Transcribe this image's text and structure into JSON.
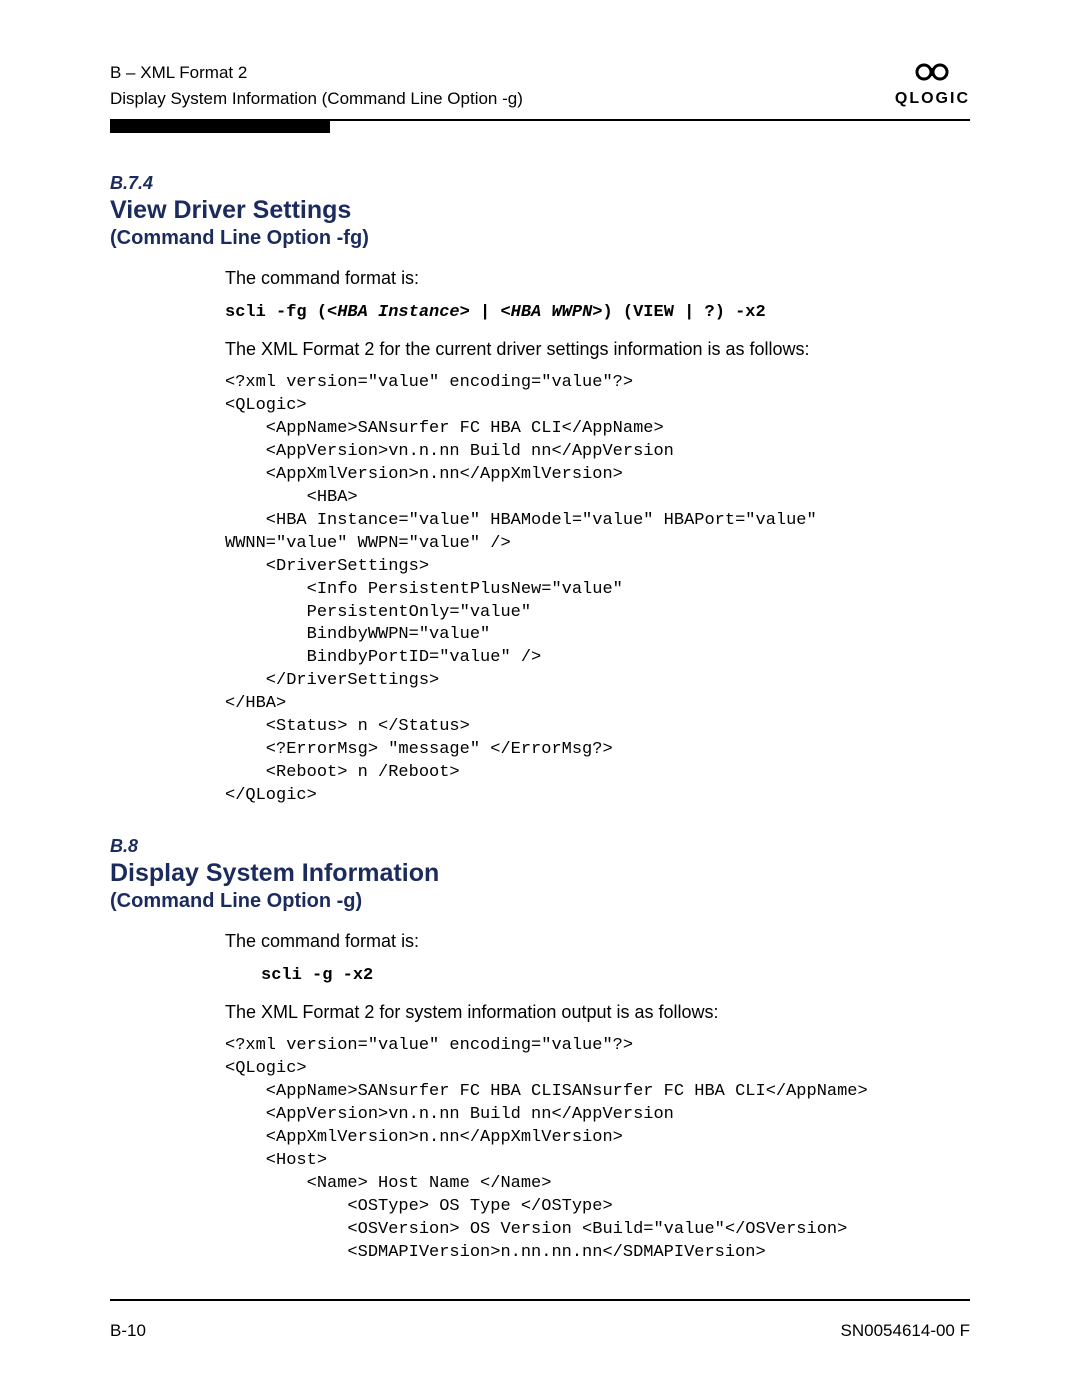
{
  "header": {
    "appendix": "B – XML Format 2",
    "topic": "Display System Information (Command Line Option -g)",
    "brand_glyph": "⚙︎",
    "brand_text": "QLOGIC"
  },
  "section1": {
    "number": "B.7.4",
    "title": "View Driver Settings",
    "subtitle": "(Command Line Option -fg)",
    "intro": "The command format is:",
    "cmd_prefix": "scli -fg (<",
    "cmd_it1": "HBA Instance",
    "cmd_mid": "> | <",
    "cmd_it2": "HBA WWPN",
    "cmd_suffix": ">) (VIEW | ?) -x2",
    "desc": "The XML Format 2 for the current driver settings information is as follows:",
    "code": "<?xml version=\"value\" encoding=\"value\"?>\n<QLogic>\n    <AppName>SANsurfer FC HBA CLI</AppName>\n    <AppVersion>vn.n.nn Build nn</AppVersion\n    <AppXmlVersion>n.nn</AppXmlVersion>\n        <HBA>\n    <HBA Instance=\"value\" HBAModel=\"value\" HBAPort=\"value\"\nWWNN=\"value\" WWPN=\"value\" />\n    <DriverSettings>\n        <Info PersistentPlusNew=\"value\"\n        PersistentOnly=\"value\"\n        BindbyWWPN=\"value\"\n        BindbyPortID=\"value\" />\n    </DriverSettings>\n</HBA>\n    <Status> n </Status>\n    <?ErrorMsg> \"message\" </ErrorMsg?>\n    <Reboot> n /Reboot>\n</QLogic>"
  },
  "section2": {
    "number": "B.8",
    "title": "Display System Information",
    "subtitle": "(Command Line Option -g)",
    "intro": "The command format is:",
    "cmd": "scli -g -x2",
    "desc": "The XML Format 2 for system information output is as follows:",
    "code": "<?xml version=\"value\" encoding=\"value\"?>\n<QLogic>\n    <AppName>SANsurfer FC HBA CLISANsurfer FC HBA CLI</AppName>\n    <AppVersion>vn.n.nn Build nn</AppVersion\n    <AppXmlVersion>n.nn</AppXmlVersion>\n    <Host>\n        <Name> Host Name </Name>\n            <OSType> OS Type </OSType>\n            <OSVersion> OS Version <Build=\"value\"</OSVersion>\n            <SDMAPIVersion>n.nn.nn.nn</SDMAPIVersion>"
  },
  "footer": {
    "page": "B-10",
    "docnum": "SN0054614-00  F"
  }
}
